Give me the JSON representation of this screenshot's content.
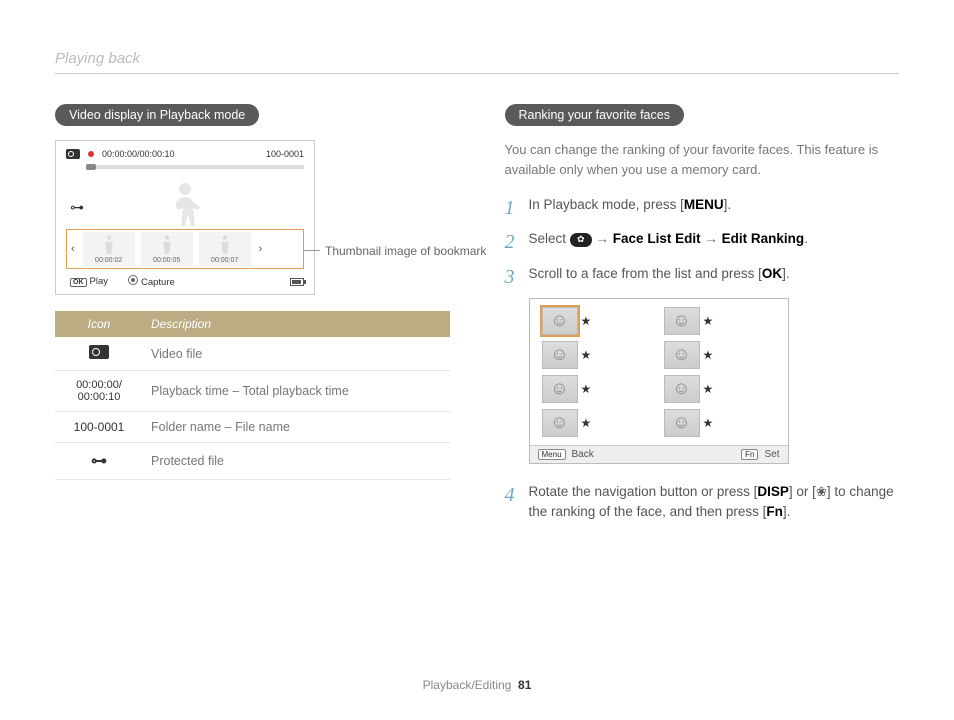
{
  "header": {
    "section_title": "Playing back"
  },
  "left": {
    "pill": "Video display in Playback mode",
    "panel": {
      "time": "00:00:00/00:00:10",
      "file": "100-0001",
      "thumbs": [
        "00:00:02",
        "00:00:05",
        "00:00:07"
      ],
      "play_label": "Play",
      "capture_label": "Capture"
    },
    "callout": "Thumbnail image of bookmark",
    "table": {
      "head_icon": "Icon",
      "head_desc": "Description",
      "rows": [
        {
          "icon_type": "cam",
          "desc": "Video file"
        },
        {
          "icon_type": "time",
          "icon_text": "00:00:00/\n00:00:10",
          "desc": "Playback time – Total playback time"
        },
        {
          "icon_type": "text",
          "icon_text": "100-0001",
          "desc": "Folder name – File name"
        },
        {
          "icon_type": "lock",
          "desc": "Protected file"
        }
      ]
    }
  },
  "right": {
    "pill": "Ranking your favorite faces",
    "intro": "You can change the ranking of your favorite faces. This feature is available only when you use a memory card.",
    "steps": {
      "s1_a": "In Playback mode, press [",
      "s1_key": "MENU",
      "s1_b": "].",
      "s2_a": "Select ",
      "s2_arrow": " → ",
      "s2_face_list": "Face List Edit",
      "s2_edit_rank": "Edit Ranking",
      "s2_end": ".",
      "s3_a": "Scroll to a face from the list and press [",
      "s3_key": "OK",
      "s3_b": "].",
      "s4_a": "Rotate the navigation button or press [",
      "s4_key1": "DISP",
      "s4_b": "] or [",
      "s4_c": "] to change the ranking of the face, and then press [",
      "s4_key2": "Fn",
      "s4_d": "]."
    },
    "face_panel": {
      "menu_btn": "Menu",
      "back": "Back",
      "fn_btn": "Fn",
      "set": "Set"
    }
  },
  "footer": {
    "section": "Playback/Editing",
    "page": "81"
  }
}
